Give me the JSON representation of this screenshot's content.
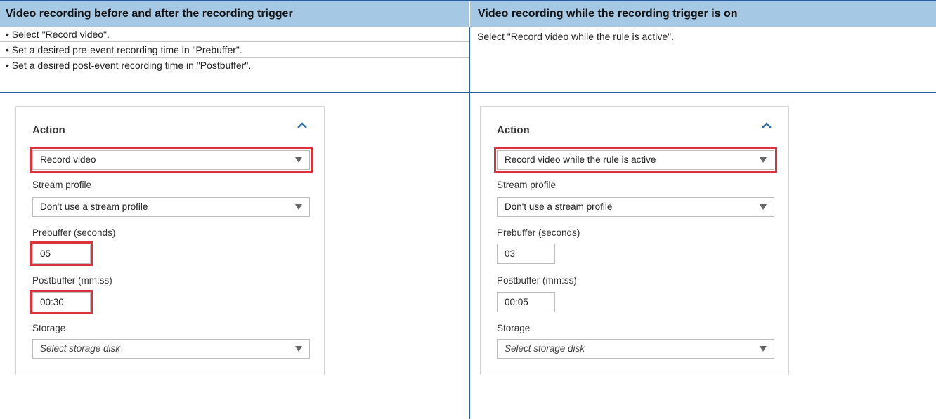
{
  "header": {
    "left_title": "Video recording before and after the recording trigger",
    "right_title": "Video recording while the recording trigger is on"
  },
  "instructions": {
    "left": [
      "• Select \"Record video\".",
      "• Set a desired pre-event recording time in \"Prebuffer\".",
      "• Set a desired post-event recording time in \"Postbuffer\"."
    ],
    "right": "Select \"Record video while the rule is active\"."
  },
  "panels": {
    "left": {
      "title": "Action",
      "action_value": "Record video",
      "stream_profile_label": "Stream profile",
      "stream_profile_value": "Don't use a stream profile",
      "prebuffer_label": "Prebuffer (seconds)",
      "prebuffer_value": "05",
      "postbuffer_label": "Postbuffer (mm:ss)",
      "postbuffer_value": "00:30",
      "storage_label": "Storage",
      "storage_placeholder": "Select storage disk"
    },
    "right": {
      "title": "Action",
      "action_value": "Record video while the rule is active",
      "stream_profile_label": "Stream profile",
      "stream_profile_value": "Don't use a stream profile",
      "prebuffer_label": "Prebuffer (seconds)",
      "prebuffer_value": "03",
      "postbuffer_label": "Postbuffer (mm:ss)",
      "postbuffer_value": "00:05",
      "storage_label": "Storage",
      "storage_placeholder": "Select storage disk"
    }
  },
  "icons": {
    "collapse": "chevron-up-icon",
    "dropdown": "caret-down-icon"
  },
  "colors": {
    "header_bg": "#a5c8e4",
    "rule_blue": "#2a5d9a",
    "highlight_red": "#d9343c",
    "chevron_blue": "#2b6fa8"
  }
}
